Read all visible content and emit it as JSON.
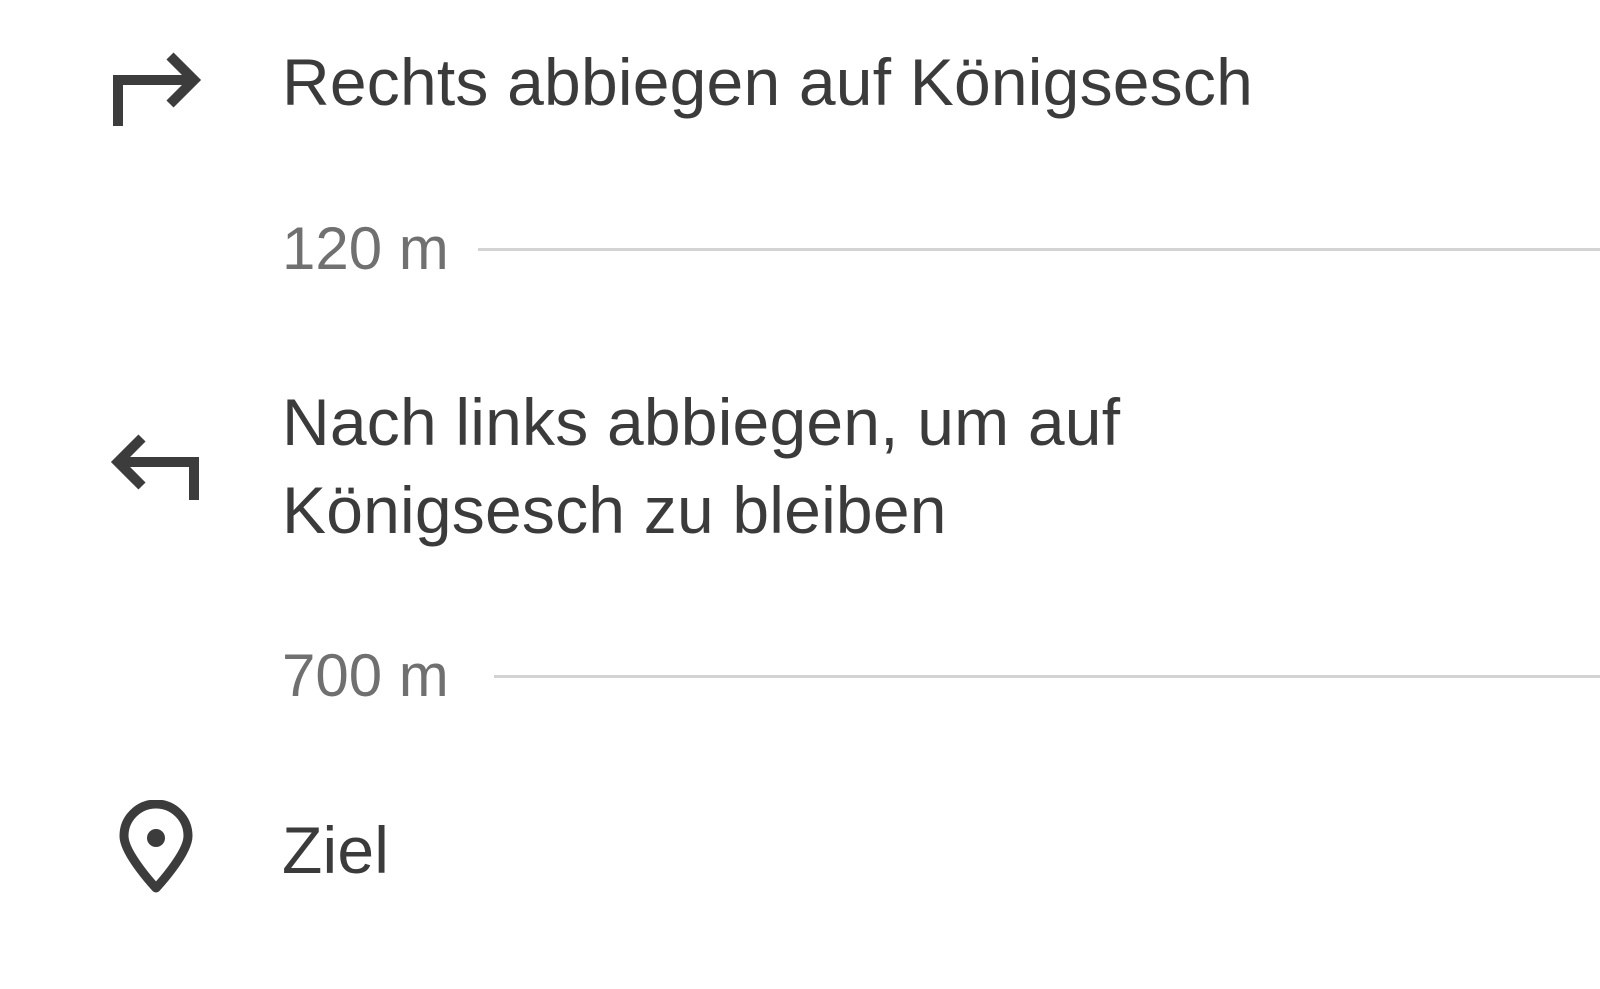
{
  "directions": {
    "steps": [
      {
        "icon": "turn-right-icon",
        "lines": [
          "Rechts abbiegen auf Königsesch"
        ]
      },
      {
        "icon": "turn-left-icon",
        "lines": [
          "Nach links abbiegen, um auf",
          "Königsesch zu bleiben"
        ]
      },
      {
        "icon": "location-pin-icon",
        "lines": [
          "Ziel"
        ]
      }
    ],
    "distances": [
      "120 m",
      "700 m"
    ]
  },
  "colors": {
    "text": "#3b3b3b",
    "distance_text": "#707070",
    "icon": "#3c3c3c",
    "divider": "#d3d3d3",
    "background": "#ffffff"
  }
}
